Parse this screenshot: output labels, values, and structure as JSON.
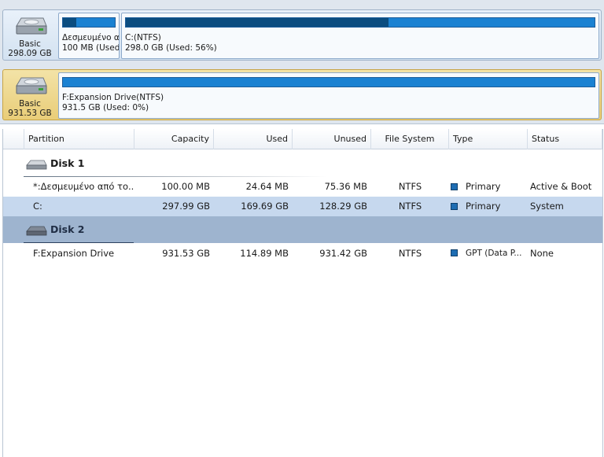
{
  "disk_map": {
    "disk1": {
      "type_label": "Basic",
      "size_label": "298.09 GB",
      "partitions": [
        {
          "name": "Δεσμευμένο αι",
          "detail": "100 MB (Used:",
          "used_fraction": 0.25
        },
        {
          "name": "C:(NTFS)",
          "detail": "298.0 GB (Used: 56%)",
          "used_fraction": 0.56
        }
      ]
    },
    "disk2": {
      "type_label": "Basic",
      "size_label": "931.53 GB",
      "partitions": [
        {
          "name": "F:Expansion Drive(NTFS)",
          "detail": "931.5 GB (Used: 0%)",
          "used_fraction": 0.0
        }
      ]
    }
  },
  "table": {
    "columns": {
      "partition": "Partition",
      "capacity": "Capacity",
      "used": "Used",
      "unused": "Unused",
      "file_system": "File System",
      "type": "Type",
      "status": "Status"
    },
    "disk1_label": "Disk 1",
    "disk2_label": "Disk 2",
    "rows": [
      {
        "partition": "*:Δεσμευμένο από το...",
        "capacity": "100.00 MB",
        "used": "24.64 MB",
        "unused": "75.36 MB",
        "file_system": "NTFS",
        "type": "Primary",
        "status": "Active & Boot"
      },
      {
        "partition": "C:",
        "capacity": "297.99 GB",
        "used": "169.69 GB",
        "unused": "128.29 GB",
        "file_system": "NTFS",
        "type": "Primary",
        "status": "System"
      },
      {
        "partition": "F:Expansion Drive",
        "capacity": "931.53 GB",
        "used": "114.89 MB",
        "unused": "931.42 GB",
        "file_system": "NTFS",
        "type": "GPT (Data P...",
        "status": "None"
      }
    ],
    "selected_row": 1
  },
  "colors": {
    "usage_fill": "#0b4d80",
    "usage_free": "#1b82d2",
    "selected_disk_bg": "#e9cd78",
    "selected_row_bg": "#c6d8ee",
    "disk2_header_bg": "#9eb4cf",
    "type_square": "#1e6db2"
  },
  "icons": {
    "disk": "hard-drive-icon",
    "type_marker": "square-icon"
  }
}
